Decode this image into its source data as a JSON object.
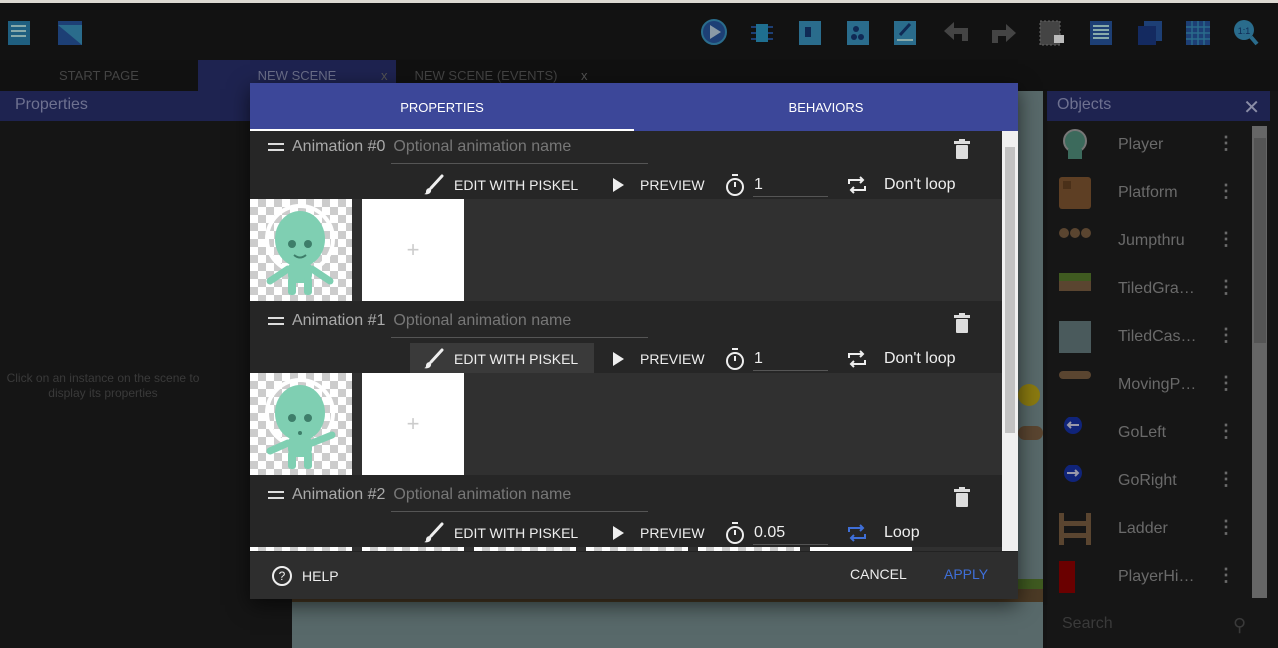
{
  "toolbar": {
    "left_icons": [
      "project-manager-icon",
      "scene-window-icon"
    ],
    "right_icons": [
      "preview-icon",
      "debug-icon",
      "object-groups-icon",
      "instances-list-icon",
      "layers-icon",
      "undo-icon",
      "redo-icon",
      "properties-panel-icon",
      "objects-list-icon",
      "window-mask-icon",
      "grid-icon",
      "zoom-reset-icon"
    ]
  },
  "tabs": [
    {
      "label": "START PAGE"
    },
    {
      "label": "NEW SCENE",
      "close": "x"
    },
    {
      "label": "NEW SCENE (EVENTS)",
      "close": "x"
    }
  ],
  "properties_panel": {
    "title": "Properties",
    "empty_text": "Click on an instance on the scene to display its properties"
  },
  "objects_panel": {
    "title": "Objects",
    "close": "✕",
    "search_placeholder": "Search",
    "items": [
      {
        "label": "Player"
      },
      {
        "label": "Platform"
      },
      {
        "label": "Jumpthru"
      },
      {
        "label": "TiledGra…"
      },
      {
        "label": "TiledCas…"
      },
      {
        "label": "MovingP…"
      },
      {
        "label": "GoLeft"
      },
      {
        "label": "GoRight"
      },
      {
        "label": "Ladder"
      },
      {
        "label": "PlayerHi…"
      }
    ]
  },
  "dialog": {
    "tabs": [
      {
        "label": "PROPERTIES"
      },
      {
        "label": "BEHAVIORS"
      }
    ],
    "animations": [
      {
        "title": "Animation #0",
        "name_placeholder": "Optional animation name",
        "edit_label": "EDIT WITH PISKEL",
        "preview_label": "PREVIEW",
        "time_between_frames": "1",
        "loop_label": "Don't loop",
        "loop": false,
        "add_frame": "+"
      },
      {
        "title": "Animation #1",
        "name_placeholder": "Optional animation name",
        "edit_label": "EDIT WITH PISKEL",
        "preview_label": "PREVIEW",
        "time_between_frames": "1",
        "loop_label": "Don't loop",
        "loop": false,
        "add_frame": "+"
      },
      {
        "title": "Animation #2",
        "name_placeholder": "Optional animation name",
        "edit_label": "EDIT WITH PISKEL",
        "preview_label": "PREVIEW",
        "time_between_frames": "0.05",
        "loop_label": "Loop",
        "loop": true
      }
    ],
    "footer": {
      "help": "HELP",
      "cancel": "CANCEL",
      "apply": "APPLY"
    }
  },
  "colors": {
    "accent": "#3c4799",
    "apply": "#3f6fd8",
    "loop_active": "#3f6fd8"
  }
}
